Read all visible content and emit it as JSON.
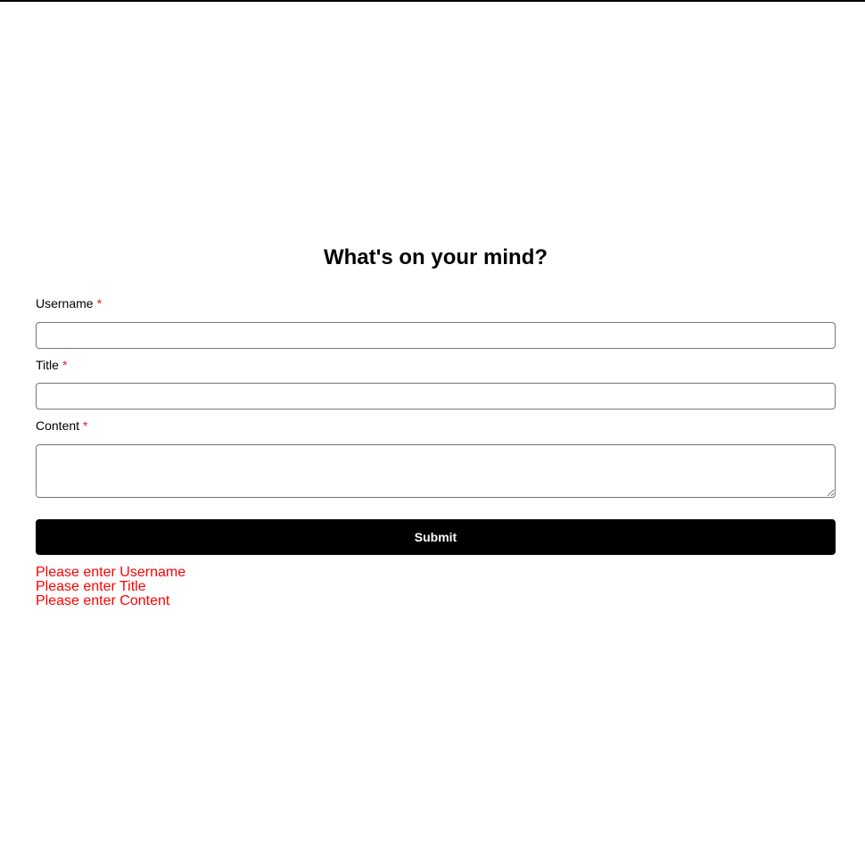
{
  "form": {
    "title": "What's on your mind?",
    "fields": {
      "username": {
        "label": "Username",
        "required_mark": "*",
        "value": ""
      },
      "title": {
        "label": "Title",
        "required_mark": "*",
        "value": ""
      },
      "content": {
        "label": "Content",
        "required_mark": "*",
        "value": ""
      }
    },
    "submit_label": "Submit",
    "errors": [
      "Please enter Username",
      "Please enter Title",
      "Please enter Content"
    ]
  },
  "colors": {
    "required_mark": "#e0201b",
    "error_text": "#ff0000",
    "button_bg": "#000000",
    "button_text": "#ffffff"
  }
}
